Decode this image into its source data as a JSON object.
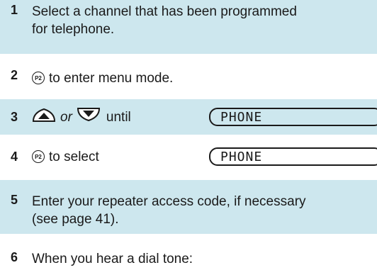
{
  "steps": [
    {
      "number": "1",
      "text_line1": "Select a channel that has been programmed",
      "text_line2": "for telephone."
    },
    {
      "number": "2",
      "button": "P2",
      "text": "to enter menu mode."
    },
    {
      "number": "3",
      "or_label": "or",
      "text": "until",
      "display": "PHONE"
    },
    {
      "number": "4",
      "button": "P2",
      "text": "to select",
      "display": "PHONE"
    },
    {
      "number": "5",
      "text_line1": "Enter your repeater access code, if necessary",
      "text_line2": "(see page 41)."
    },
    {
      "number": "6",
      "text": "When you hear a dial tone:"
    }
  ]
}
